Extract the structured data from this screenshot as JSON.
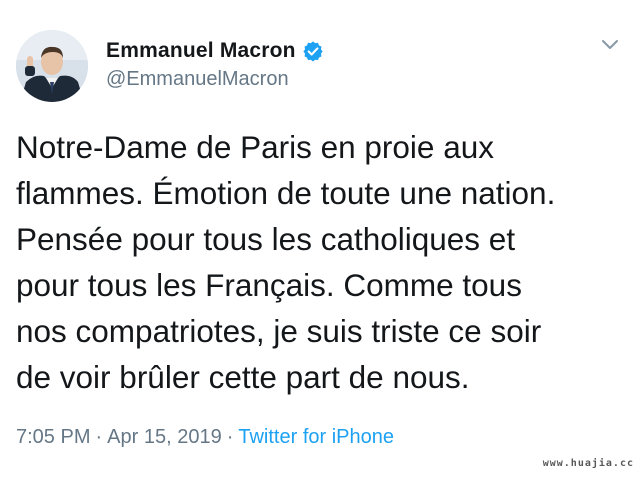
{
  "author": {
    "display_name": "Emmanuel Macron",
    "handle": "@EmmanuelMacron",
    "verified": true,
    "avatar_icon": "profile-photo"
  },
  "tweet": {
    "lines": [
      "Notre-Dame de Paris en proie aux",
      "flammes. Émotion de toute une nation.",
      "Pensée pour tous les catholiques et",
      "pour tous les Français. Comme tous",
      "nos compatriotes, je suis triste ce soir",
      "de voir brûler cette part de nous."
    ]
  },
  "meta": {
    "time": "7:05 PM",
    "date": "Apr 15, 2019",
    "separator": "·",
    "source": "Twitter for iPhone"
  },
  "icons": {
    "verified": "verified-badge-icon",
    "menu": "chevron-down-icon"
  },
  "colors": {
    "text": "#14171a",
    "secondary": "#657786",
    "link": "#1da1f2",
    "verified": "#1da1f2"
  },
  "watermark": "www.huajia.cc"
}
